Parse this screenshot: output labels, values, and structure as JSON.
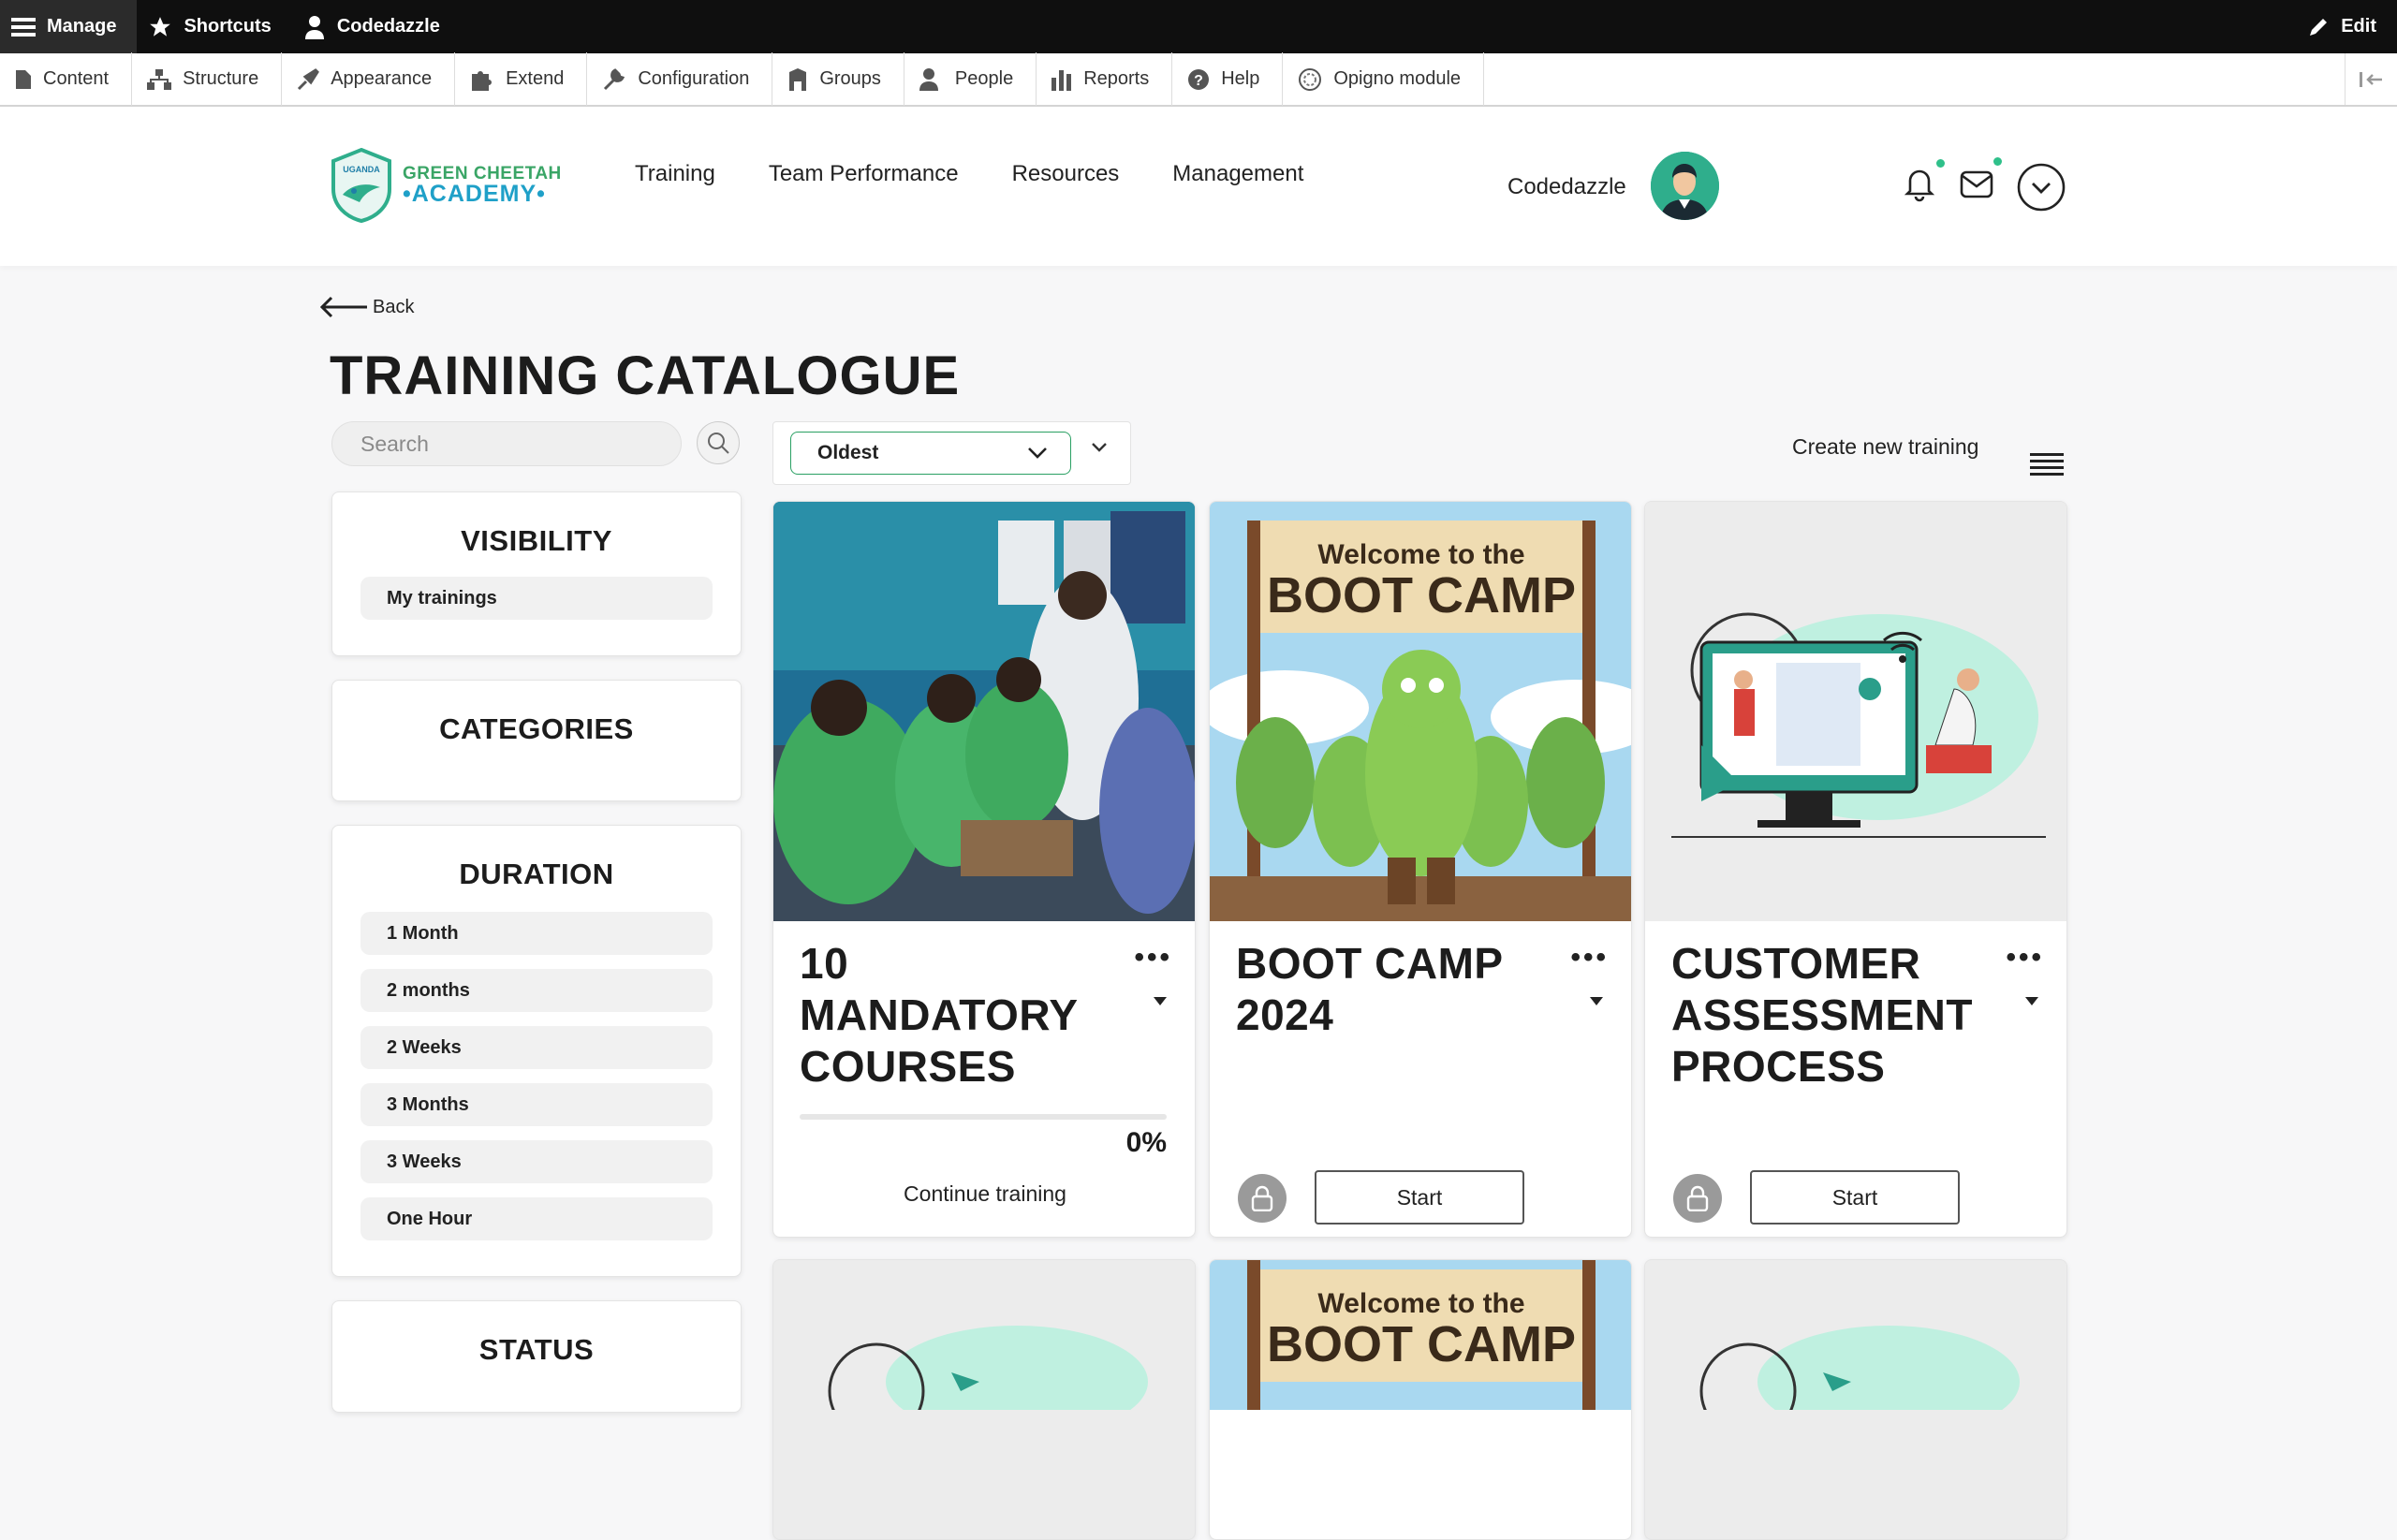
{
  "admin_toolbar": {
    "manage": "Manage",
    "shortcuts": "Shortcuts",
    "user": "Codedazzle",
    "edit": "Edit"
  },
  "admin_tray": [
    {
      "label": "Content",
      "icon": "file-icon"
    },
    {
      "label": "Structure",
      "icon": "sitemap-icon"
    },
    {
      "label": "Appearance",
      "icon": "wrench-icon"
    },
    {
      "label": "Extend",
      "icon": "puzzle-icon"
    },
    {
      "label": "Configuration",
      "icon": "wrench-icon"
    },
    {
      "label": "Groups",
      "icon": "building-icon"
    },
    {
      "label": "People",
      "icon": "person-icon"
    },
    {
      "label": "Reports",
      "icon": "bar-chart-icon"
    },
    {
      "label": "Help",
      "icon": "help-icon"
    },
    {
      "label": "Opigno module",
      "icon": "circle-icon"
    }
  ],
  "logo": {
    "badge_text": "UGANDA",
    "line1": "GREEN CHEETAH",
    "line2": "•ACADEMY•"
  },
  "main_nav": [
    "Training",
    "Team Performance",
    "Resources",
    "Management"
  ],
  "header_user": "Codedazzle",
  "back_label": "Back",
  "page_title": "TRAINING CATALOGUE",
  "search": {
    "placeholder": "Search"
  },
  "sort": {
    "selected": "Oldest"
  },
  "create_link": "Create new training",
  "filters": {
    "visibility": {
      "title": "VISIBILITY",
      "items": [
        "My trainings"
      ]
    },
    "categories": {
      "title": "CATEGORIES"
    },
    "duration": {
      "title": "DURATION",
      "items": [
        "1 Month",
        "2 months",
        "2 Weeks",
        "3 Months",
        "3 Weeks",
        "One Hour"
      ]
    },
    "status": {
      "title": "STATUS"
    }
  },
  "banner_text": {
    "line1": "Welcome to the",
    "line2": "BOOT CAMP"
  },
  "cards": [
    {
      "title_lines": [
        "10",
        "MANDATORY",
        "COURSES"
      ],
      "progress": 0,
      "progress_label": "0%",
      "action": "Continue training"
    },
    {
      "title_lines": [
        "BOOT CAMP",
        "2024"
      ],
      "action": "Start"
    },
    {
      "title_lines": [
        "CUSTOMER",
        "ASSESSMENT",
        "PROCESS"
      ],
      "action": "Start"
    }
  ],
  "colors": {
    "brand_green": "#2aa063",
    "toolbar_bg": "#0f0f0f"
  }
}
